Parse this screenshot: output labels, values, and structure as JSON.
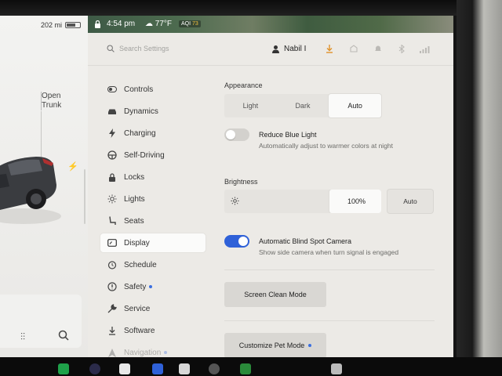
{
  "status": {
    "range": "202 mi",
    "time": "4:54 pm",
    "temperature": "77°F",
    "aqi_label": "AQI",
    "aqi_value": "73"
  },
  "car_panel": {
    "trunk_line1": "Open",
    "trunk_line2": "Trunk"
  },
  "header": {
    "search_placeholder": "Search Settings",
    "user_name": "Nabil I"
  },
  "sidebar": {
    "items": [
      {
        "label": "Controls",
        "icon": "toggle-icon"
      },
      {
        "label": "Dynamics",
        "icon": "car-icon"
      },
      {
        "label": "Charging",
        "icon": "bolt-icon"
      },
      {
        "label": "Self-Driving",
        "icon": "steering-wheel-icon"
      },
      {
        "label": "Locks",
        "icon": "lock-icon"
      },
      {
        "label": "Lights",
        "icon": "light-icon"
      },
      {
        "label": "Seats",
        "icon": "seat-icon"
      },
      {
        "label": "Display",
        "icon": "display-icon",
        "active": true
      },
      {
        "label": "Schedule",
        "icon": "alarm-icon"
      },
      {
        "label": "Safety",
        "icon": "info-icon",
        "dot": true
      },
      {
        "label": "Service",
        "icon": "wrench-icon"
      },
      {
        "label": "Software",
        "icon": "download-icon"
      },
      {
        "label": "Navigation",
        "icon": "navigation-icon",
        "dot": true
      }
    ]
  },
  "display": {
    "appearance_title": "Appearance",
    "appearance_options": [
      "Light",
      "Dark",
      "Auto"
    ],
    "appearance_selected": "Auto",
    "reduce_blue_light": {
      "title": "Reduce Blue Light",
      "subtitle": "Automatically adjust to warmer colors at night",
      "enabled": false
    },
    "brightness_title": "Brightness",
    "brightness_value": "100%",
    "brightness_level": 0.33,
    "brightness_auto_label": "Auto",
    "blind_spot": {
      "title": "Automatic Blind Spot Camera",
      "subtitle": "Show side camera when turn signal is engaged",
      "enabled": true
    },
    "screen_clean_label": "Screen Clean Mode",
    "pet_mode_label": "Customize Pet Mode"
  },
  "colors": {
    "accent": "#2f61d8",
    "dot": "#3b6fe0"
  }
}
